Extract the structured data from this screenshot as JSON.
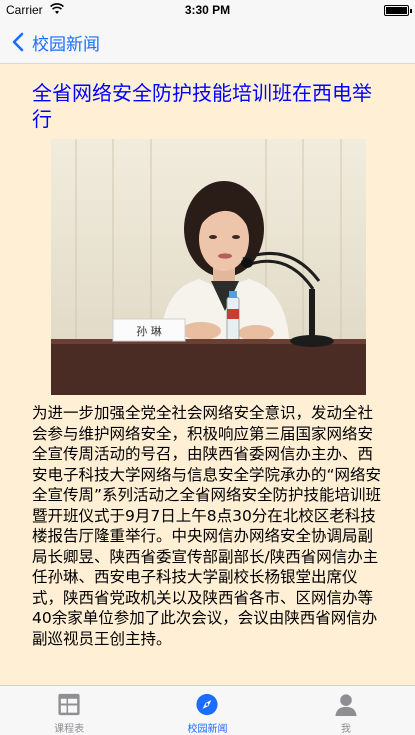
{
  "status_bar": {
    "carrier": "Carrier",
    "time": "3:30 PM"
  },
  "nav": {
    "back_label": "校园新闻"
  },
  "article": {
    "title": "全省网络安全防护技能培训班在西电举行",
    "photo_nameplate": "孙 琳",
    "body": "为进一步加强全党全社会网络安全意识，发动全社会参与维护网络安全，积极响应第三届国家网络安全宣传周活动的号召，由陕西省委网信办主办、西安电子科技大学网络与信息安全学院承办的“网络安全宣传周”系列活动之全省网络安全防护技能培训班暨开班仪式于9月7日上午8点30分在北校区老科技楼报告厅隆重举行。中央网信办网络安全协调局副局长卿昱、陕西省委宣传部副部长/陕西省网信办主任孙琳、西安电子科技大学副校长杨银堂出席仪式，陕西省党政机关以及陕西省各市、区网信办等40余家单位参加了此次会议，会议由陕西省网信办副巡视员王创主持。"
  },
  "tabs": [
    {
      "label": "课程表",
      "icon": "grid-icon",
      "active": false
    },
    {
      "label": "校园新闻",
      "icon": "compass-icon",
      "active": true
    },
    {
      "label": "我",
      "icon": "person-icon",
      "active": false
    }
  ],
  "colors": {
    "accent": "#1a6dff",
    "title": "#0000ff",
    "content_background": "#ffefd4",
    "tab_inactive": "#8e8e93"
  }
}
